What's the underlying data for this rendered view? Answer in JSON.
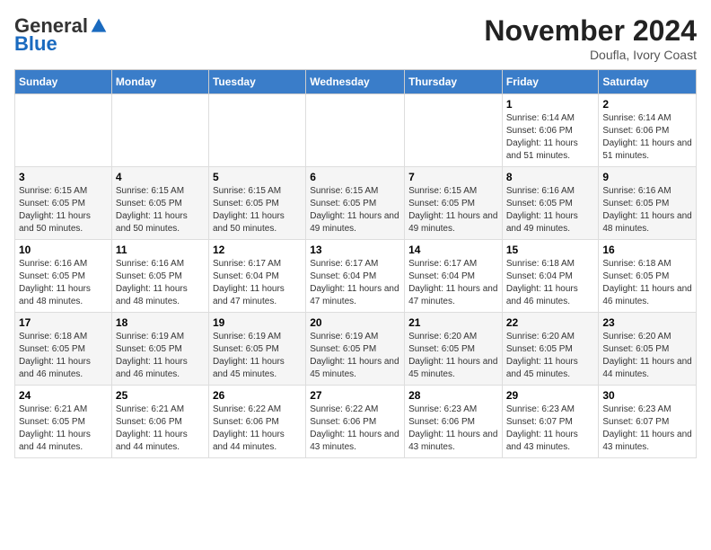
{
  "header": {
    "logo_general": "General",
    "logo_blue": "Blue",
    "month_title": "November 2024",
    "location": "Doufla, Ivory Coast"
  },
  "days_of_week": [
    "Sunday",
    "Monday",
    "Tuesday",
    "Wednesday",
    "Thursday",
    "Friday",
    "Saturday"
  ],
  "weeks": [
    [
      {
        "day": "",
        "info": ""
      },
      {
        "day": "",
        "info": ""
      },
      {
        "day": "",
        "info": ""
      },
      {
        "day": "",
        "info": ""
      },
      {
        "day": "",
        "info": ""
      },
      {
        "day": "1",
        "info": "Sunrise: 6:14 AM\nSunset: 6:06 PM\nDaylight: 11 hours and 51 minutes."
      },
      {
        "day": "2",
        "info": "Sunrise: 6:14 AM\nSunset: 6:06 PM\nDaylight: 11 hours and 51 minutes."
      }
    ],
    [
      {
        "day": "3",
        "info": "Sunrise: 6:15 AM\nSunset: 6:05 PM\nDaylight: 11 hours and 50 minutes."
      },
      {
        "day": "4",
        "info": "Sunrise: 6:15 AM\nSunset: 6:05 PM\nDaylight: 11 hours and 50 minutes."
      },
      {
        "day": "5",
        "info": "Sunrise: 6:15 AM\nSunset: 6:05 PM\nDaylight: 11 hours and 50 minutes."
      },
      {
        "day": "6",
        "info": "Sunrise: 6:15 AM\nSunset: 6:05 PM\nDaylight: 11 hours and 49 minutes."
      },
      {
        "day": "7",
        "info": "Sunrise: 6:15 AM\nSunset: 6:05 PM\nDaylight: 11 hours and 49 minutes."
      },
      {
        "day": "8",
        "info": "Sunrise: 6:16 AM\nSunset: 6:05 PM\nDaylight: 11 hours and 49 minutes."
      },
      {
        "day": "9",
        "info": "Sunrise: 6:16 AM\nSunset: 6:05 PM\nDaylight: 11 hours and 48 minutes."
      }
    ],
    [
      {
        "day": "10",
        "info": "Sunrise: 6:16 AM\nSunset: 6:05 PM\nDaylight: 11 hours and 48 minutes."
      },
      {
        "day": "11",
        "info": "Sunrise: 6:16 AM\nSunset: 6:05 PM\nDaylight: 11 hours and 48 minutes."
      },
      {
        "day": "12",
        "info": "Sunrise: 6:17 AM\nSunset: 6:04 PM\nDaylight: 11 hours and 47 minutes."
      },
      {
        "day": "13",
        "info": "Sunrise: 6:17 AM\nSunset: 6:04 PM\nDaylight: 11 hours and 47 minutes."
      },
      {
        "day": "14",
        "info": "Sunrise: 6:17 AM\nSunset: 6:04 PM\nDaylight: 11 hours and 47 minutes."
      },
      {
        "day": "15",
        "info": "Sunrise: 6:18 AM\nSunset: 6:04 PM\nDaylight: 11 hours and 46 minutes."
      },
      {
        "day": "16",
        "info": "Sunrise: 6:18 AM\nSunset: 6:05 PM\nDaylight: 11 hours and 46 minutes."
      }
    ],
    [
      {
        "day": "17",
        "info": "Sunrise: 6:18 AM\nSunset: 6:05 PM\nDaylight: 11 hours and 46 minutes."
      },
      {
        "day": "18",
        "info": "Sunrise: 6:19 AM\nSunset: 6:05 PM\nDaylight: 11 hours and 46 minutes."
      },
      {
        "day": "19",
        "info": "Sunrise: 6:19 AM\nSunset: 6:05 PM\nDaylight: 11 hours and 45 minutes."
      },
      {
        "day": "20",
        "info": "Sunrise: 6:19 AM\nSunset: 6:05 PM\nDaylight: 11 hours and 45 minutes."
      },
      {
        "day": "21",
        "info": "Sunrise: 6:20 AM\nSunset: 6:05 PM\nDaylight: 11 hours and 45 minutes."
      },
      {
        "day": "22",
        "info": "Sunrise: 6:20 AM\nSunset: 6:05 PM\nDaylight: 11 hours and 45 minutes."
      },
      {
        "day": "23",
        "info": "Sunrise: 6:20 AM\nSunset: 6:05 PM\nDaylight: 11 hours and 44 minutes."
      }
    ],
    [
      {
        "day": "24",
        "info": "Sunrise: 6:21 AM\nSunset: 6:05 PM\nDaylight: 11 hours and 44 minutes."
      },
      {
        "day": "25",
        "info": "Sunrise: 6:21 AM\nSunset: 6:06 PM\nDaylight: 11 hours and 44 minutes."
      },
      {
        "day": "26",
        "info": "Sunrise: 6:22 AM\nSunset: 6:06 PM\nDaylight: 11 hours and 44 minutes."
      },
      {
        "day": "27",
        "info": "Sunrise: 6:22 AM\nSunset: 6:06 PM\nDaylight: 11 hours and 43 minutes."
      },
      {
        "day": "28",
        "info": "Sunrise: 6:23 AM\nSunset: 6:06 PM\nDaylight: 11 hours and 43 minutes."
      },
      {
        "day": "29",
        "info": "Sunrise: 6:23 AM\nSunset: 6:07 PM\nDaylight: 11 hours and 43 minutes."
      },
      {
        "day": "30",
        "info": "Sunrise: 6:23 AM\nSunset: 6:07 PM\nDaylight: 11 hours and 43 minutes."
      }
    ]
  ]
}
